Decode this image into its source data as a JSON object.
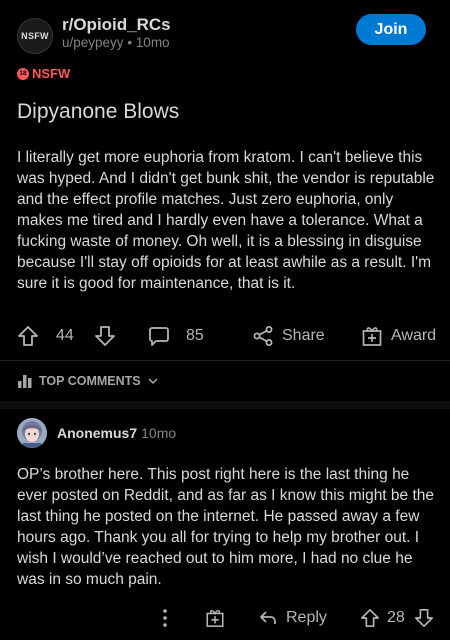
{
  "post": {
    "avatar_label": "NSFW",
    "subreddit": "r/Opioid_RCs",
    "author": "u/peypeyy",
    "age": "10mo",
    "join_label": "Join",
    "nsfw_badge_number": "18",
    "nsfw_label": "NSFW",
    "title": "Dipyanone Blows",
    "body": "I literally get more euphoria from kratom. I can't believe this was hyped. And I didn't get bunk shit, the vendor is reputable and the effect profile matches. Just zero euphoria, only makes me tired and I hardly even have a tolerance. What a fucking waste of money. Oh well, it is a blessing in disguise because I'll stay off opioids for at least awhile as a result. I'm sure it is good for maintenance, that is it.",
    "votes": "44",
    "comments": "85",
    "share_label": "Share",
    "award_label": "Award"
  },
  "sort": {
    "label": "TOP COMMENTS"
  },
  "comment": {
    "author": "Anonemus7",
    "age": "10mo",
    "text": "OP’s brother here. This post right here is the last thing he ever posted on Reddit, and as far as I know this might be the last thing he posted on the internet. He passed away a few hours ago. Thank you all for trying to help my brother out. I wish I would’ve reached out to him more, I had no clue he was in so much pain.",
    "reply_label": "Reply",
    "votes": "28"
  },
  "icons": {
    "more": "more-vertical-icon",
    "upvote": "arrow-up-icon",
    "downvote": "arrow-down-icon",
    "comment": "comment-bubble-icon",
    "share": "share-icon",
    "award": "gift-icon",
    "sort": "bar-chart-icon",
    "reply": "reply-arrow-icon"
  },
  "colors": {
    "background": "#000000",
    "join_button": "#0079d3",
    "nsfw": "#ff585b",
    "text": "#d7dadc",
    "muted": "#818384"
  }
}
